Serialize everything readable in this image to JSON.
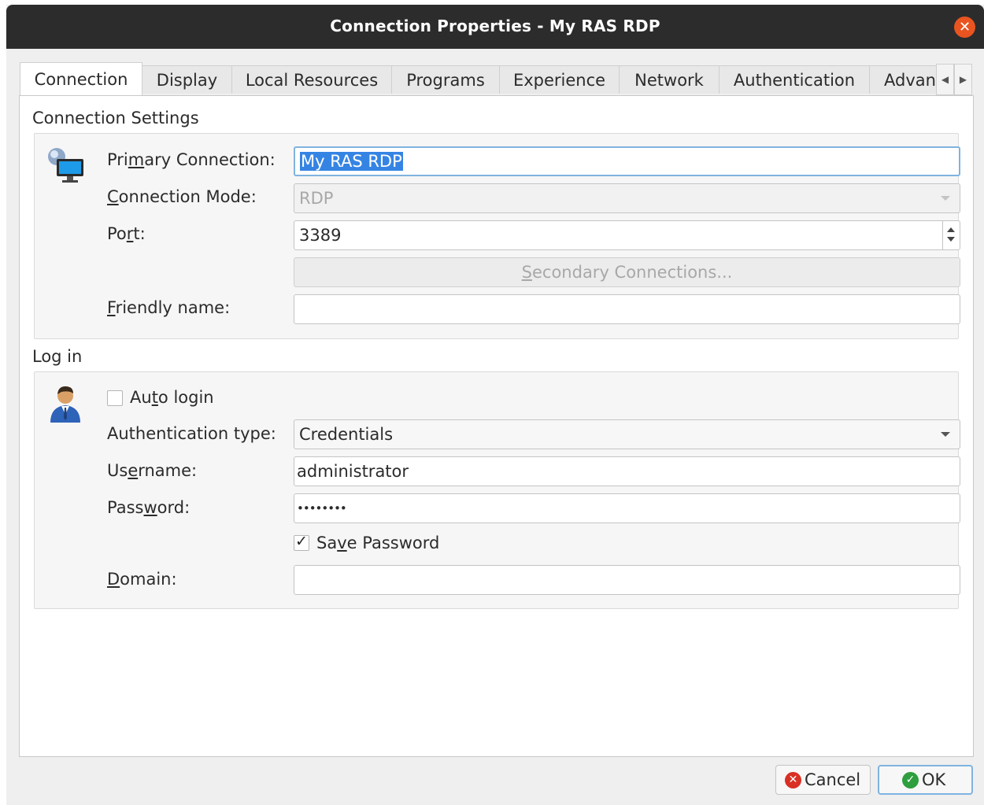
{
  "window": {
    "title": "Connection Properties - My RAS RDP"
  },
  "tabs": [
    {
      "label": "Connection"
    },
    {
      "label": "Display"
    },
    {
      "label": "Local Resources"
    },
    {
      "label": "Programs"
    },
    {
      "label": "Experience"
    },
    {
      "label": "Network"
    },
    {
      "label": "Authentication"
    },
    {
      "label": "Advan"
    }
  ],
  "connection_settings": {
    "title": "Connection Settings",
    "primary_connection": {
      "pre": "Pri",
      "key": "m",
      "post": "ary Connection:",
      "value": "My RAS RDP"
    },
    "connection_mode": {
      "pre": "",
      "key": "C",
      "post": "onnection Mode:",
      "value": "RDP"
    },
    "port": {
      "pre": "Po",
      "key": "r",
      "post": "t:",
      "value": "3389"
    },
    "secondary": {
      "pre": "",
      "key": "S",
      "post": "econdary Connections..."
    },
    "friendly_name": {
      "pre": "",
      "key": "F",
      "post": "riendly name:",
      "value": ""
    }
  },
  "login": {
    "title": "Log in",
    "auto_login": {
      "pre": "Au",
      "key": "t",
      "post": "o login",
      "checked": false
    },
    "auth_type": {
      "label": "Authentication type:",
      "value": "Credentials"
    },
    "username": {
      "pre": "Us",
      "key": "e",
      "post": "rname:",
      "value": "administrator"
    },
    "password": {
      "pre": "Pass",
      "key": "w",
      "post": "ord:",
      "value": "••••••••"
    },
    "save_password": {
      "pre": "Sa",
      "key": "v",
      "post": "e Password",
      "checked": true
    },
    "domain": {
      "pre": "",
      "key": "D",
      "post": "omain:",
      "value": ""
    }
  },
  "buttons": {
    "cancel": "Cancel",
    "ok": "OK"
  },
  "colors": {
    "titlebar": "#2c2c2c",
    "close": "#e95420",
    "selection": "#3584e4",
    "cancel_icon": "#d93025",
    "ok_icon": "#2e9e3e"
  },
  "icons": {
    "connection": "monitor-network-icon",
    "login": "user-icon",
    "close": "close-icon",
    "cancel": "cancel-icon",
    "ok": "ok-check-icon"
  }
}
